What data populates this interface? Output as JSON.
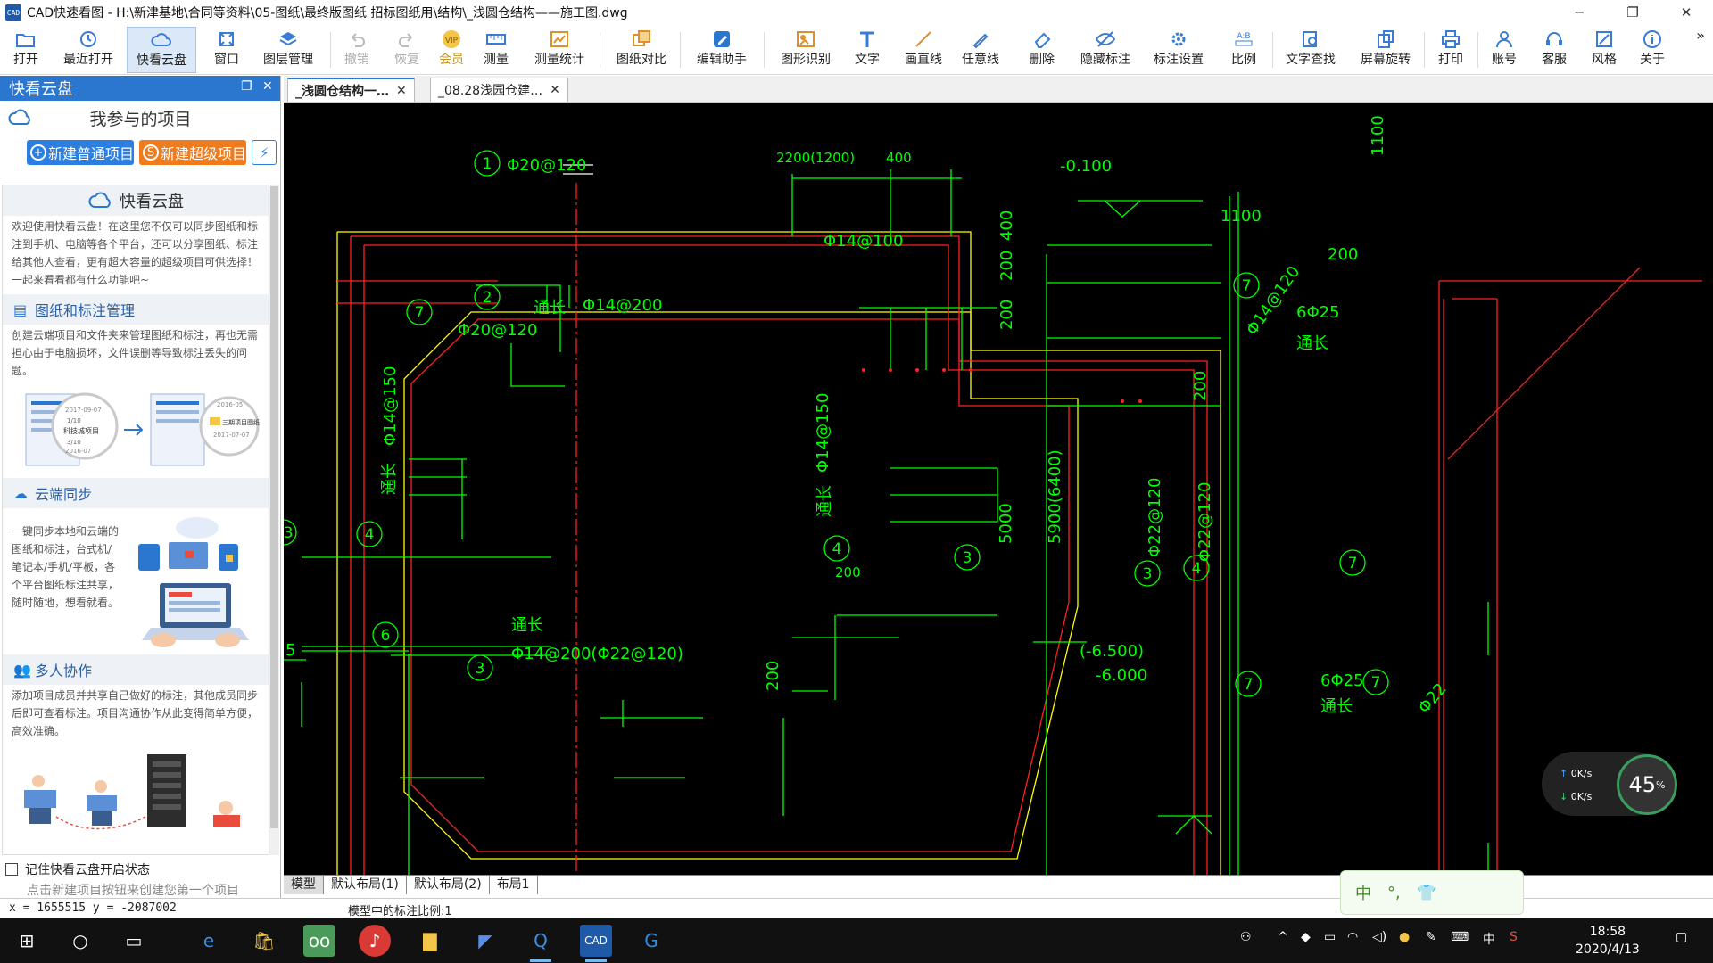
{
  "window": {
    "title": "CAD快速看图 - H:\\新津基地\\合同等资料\\05-图纸\\最终版图纸 招标图纸用\\结构\\_浅圆仓结构——施工图.dwg",
    "app_icon_text": "CAD"
  },
  "toolbar": {
    "items": [
      {
        "label": "打开",
        "icon": "folder-open-icon"
      },
      {
        "label": "最近打开",
        "icon": "history-icon"
      },
      {
        "label": "快看云盘",
        "icon": "cloud-icon"
      },
      {
        "label": "窗口",
        "icon": "window-icon"
      },
      {
        "label": "图层管理",
        "icon": "layers-icon"
      },
      {
        "label": "撤销",
        "icon": "undo-icon"
      },
      {
        "label": "恢复",
        "icon": "redo-icon"
      },
      {
        "label": "会员",
        "icon": "vip-icon"
      },
      {
        "label": "测量",
        "icon": "measure-icon"
      },
      {
        "label": "测量统计",
        "icon": "measure-stats-icon"
      },
      {
        "label": "图纸对比",
        "icon": "compare-icon"
      },
      {
        "label": "编辑助手",
        "icon": "edit-assistant-icon"
      },
      {
        "label": "图形识别",
        "icon": "shape-recognition-icon"
      },
      {
        "label": "文字",
        "icon": "text-icon"
      },
      {
        "label": "画直线",
        "icon": "line-icon"
      },
      {
        "label": "任意线",
        "icon": "freehand-icon"
      },
      {
        "label": "删除",
        "icon": "eraser-icon"
      },
      {
        "label": "隐藏标注",
        "icon": "hide-annotation-icon"
      },
      {
        "label": "标注设置",
        "icon": "annotation-settings-icon"
      },
      {
        "label": "比例",
        "icon": "scale-icon"
      },
      {
        "label": "文字查找",
        "icon": "text-search-icon"
      },
      {
        "label": "屏幕旋转",
        "icon": "rotate-screen-icon"
      },
      {
        "label": "打印",
        "icon": "print-icon"
      },
      {
        "label": "账号",
        "icon": "account-icon"
      },
      {
        "label": "客服",
        "icon": "headset-icon"
      },
      {
        "label": "风格",
        "icon": "style-icon"
      },
      {
        "label": "关于",
        "icon": "info-icon"
      }
    ],
    "more": "»"
  },
  "left_panel": {
    "header": "快看云盘",
    "subtitle": "我参与的项目",
    "new_normal_button": "新建普通项目",
    "new_super_button": "新建超级项目",
    "welcome_title": "快看云盘",
    "welcome_text": "欢迎使用快看云盘！在这里您不仅可以同步图纸和标注到手机、电脑等各个平台，还可以分享图纸、标注给其他人查看，更有超大容量的超级项目可供选择！一起来看看都有什么功能吧~",
    "sections": [
      {
        "title": "图纸和标注管理",
        "text": "创建云端项目和文件夹来管理图纸和标注，再也无需担心由于电脑损坏，文件误删等导致标注丢失的问题。"
      },
      {
        "title": "云端同步",
        "text": "一键同步本地和云端的图纸和标注，台式机/笔记本/手机/平板，各个平台图纸标注共享，随时随地，想看就看。"
      },
      {
        "title": "多人协作",
        "text": "添加项目成员并共享自己做好的标注，其他成员同步后即可查看标注。项目沟通协作从此变得简单方便，高效准确。"
      }
    ],
    "illus_labels": {
      "date1": "2017-09-07",
      "count1": "1/10",
      "name1": "科技城项目",
      "count2": "3/10",
      "date2": "2016-07",
      "date3": "2016-05",
      "name3": "三期项目图纸",
      "date4": "2017-07-07"
    },
    "remember_label": "记住快看云盘开启状态",
    "hint": "点击新建项目按钮来创建您第一个项目"
  },
  "tabs": [
    {
      "label": "_浅圆仓结构一…",
      "active": true
    },
    {
      "label": "_08.28浅园仓建…",
      "active": false
    }
  ],
  "layout_tabs": [
    "模型",
    "默认布局(1)",
    "默认布局(2)",
    "布局1"
  ],
  "status": {
    "coords": "x = 1655515  y = -2087002",
    "scale": "模型中的标注比例:1"
  },
  "drawing_texts": {
    "t1": "Φ20@120",
    "t2": "2200(1200)",
    "t3": "400",
    "t4": "-0.100",
    "t5": "1100",
    "t6": "1100",
    "t7": "Φ14@100",
    "t8": "200",
    "t9": "Φ20@120",
    "t10": "通长",
    "t11": "Φ14@200",
    "t12": "400",
    "t13": "200",
    "t14": "200",
    "t15": "6Φ25",
    "t16": "Φ14@120",
    "t17": "通长",
    "t18": "Φ14@150",
    "t19": "Φ14@150",
    "t20": "通长",
    "t21": "通长",
    "t22": "200",
    "t23": "5000",
    "t24": "5900(6400)",
    "t25": "Φ22@120",
    "t26": "Φ22@120",
    "t27": "200",
    "t28": "通长",
    "t29": "Φ14@200(Φ22@120)",
    "t30": "(-6.500)",
    "t31": "-6.000",
    "t32": "6Φ25",
    "t33": "通长",
    "t34": "200",
    "t35": "5",
    "t36": "Φ22"
  },
  "callouts": [
    "1",
    "2",
    "7",
    "7",
    "4",
    "3",
    "4",
    "3",
    "3",
    "4",
    "7",
    "6",
    "3",
    "7",
    "7"
  ],
  "net_widget": {
    "up": "0K/s",
    "down": "0K/s",
    "percent": "45",
    "percent_unit": "%"
  },
  "ime": {
    "lang": "中",
    "punct": "°,",
    "shirt": "👕"
  },
  "taskbar": {
    "time": "18:58",
    "date": "2020/4/13",
    "ime_indicator": "中",
    "apps": [
      "start-icon",
      "search-icon",
      "task-view-icon",
      "edge-icon",
      "store-icon",
      "tripadvisor-icon",
      "netease-music-icon",
      "file-explorer-icon",
      "feishu-icon",
      "qq-browser-icon",
      "cad-icon",
      "sogou-icon"
    ]
  },
  "colors": {
    "accent": "#2b77d0",
    "canvas_bg": "#000000",
    "cad_green": "#00ff00",
    "cad_red": "#ff2020",
    "cad_yellow": "#ffff00"
  }
}
